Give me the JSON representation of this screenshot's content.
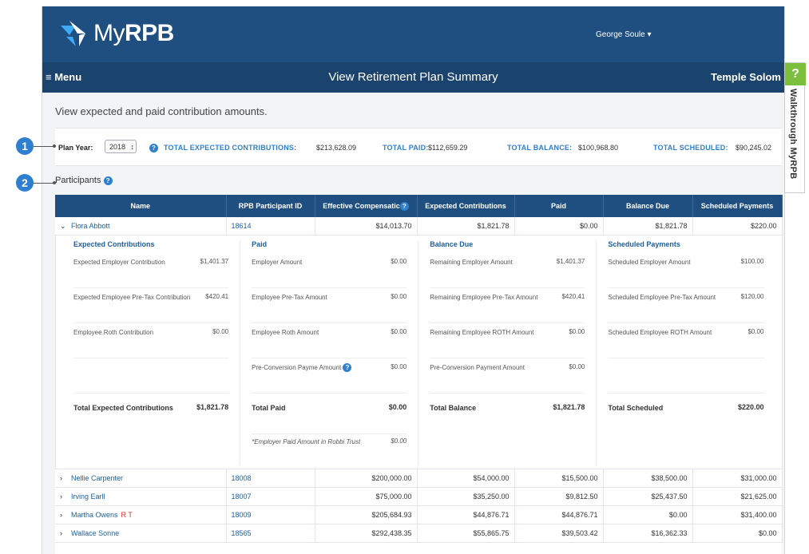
{
  "header": {
    "logo_text_my": "My",
    "logo_text_rpb": "RPB",
    "user_name": "George Soule"
  },
  "menubar": {
    "menu_label": "Menu",
    "page_title": "View Retirement Plan Summary",
    "organization": "Temple Solom"
  },
  "intro": "View expected and paid contribution amounts.",
  "plan": {
    "year_label": "Plan Year:",
    "year_value": "2018",
    "totals": [
      {
        "label": "TOTAL EXPECTED CONTRIBUTIONS:",
        "value": "$213,628.09"
      },
      {
        "label": "TOTAL PAID:",
        "value": "$112,659.29"
      },
      {
        "label": "TOTAL BALANCE:",
        "value": "$100,968.80"
      },
      {
        "label": "TOTAL SCHEDULED:",
        "value": "$90,245.02"
      }
    ]
  },
  "participants_label": "Participants",
  "table": {
    "columns": [
      "Name",
      "RPB Participant ID",
      "Effective Compensatic",
      "Expected Contributions",
      "Paid",
      "Balance Due",
      "Scheduled Payments"
    ],
    "expanded": {
      "name": "Flora Abbott",
      "id": "18614",
      "comp": "$14,013.70",
      "expected": "$1,821.78",
      "paid": "$0.00",
      "balance": "$1,821.78",
      "scheduled": "$220.00"
    },
    "details": {
      "expected": {
        "title": "Expected Contributions",
        "rows": [
          {
            "label": "Expected Employer Contribution",
            "value": "$1,401.37"
          },
          {
            "label": "Expected Employee Pre-Tax Contribution",
            "value": "$420.41"
          },
          {
            "label": "Employee Roth Contribution",
            "value": "$0.00"
          }
        ],
        "total_label": "Total Expected Contributions",
        "total_value": "$1,821.78"
      },
      "paid": {
        "title": "Paid",
        "rows": [
          {
            "label": "Employer Amount",
            "value": "$0.00"
          },
          {
            "label": "Employee Pre-Tax Amount",
            "value": "$0.00"
          },
          {
            "label": "Employee Roth Amount",
            "value": "$0.00"
          },
          {
            "label": "Pre-Conversion Payme Amount",
            "value": "$0.00"
          }
        ],
        "total_label": "Total Paid",
        "total_value": "$0.00",
        "note_label": "*Employer Paid Amount in Robbi Trust",
        "note_value": "$0.00"
      },
      "balance": {
        "title": "Balance Due",
        "rows": [
          {
            "label": "Remaining Employer Amount",
            "value": "$1,401.37"
          },
          {
            "label": "Remaining Employee Pre-Tax Amount",
            "value": "$420.41"
          },
          {
            "label": "Remaining Employee ROTH Amount",
            "value": "$0.00"
          },
          {
            "label": "Pre-Conversion Payment Amount",
            "value": "$0.00"
          }
        ],
        "total_label": "Total Balance",
        "total_value": "$1,821.78"
      },
      "scheduled": {
        "title": "Scheduled Payments",
        "rows": [
          {
            "label": "Scheduled Employer Amount",
            "value": "$100.00"
          },
          {
            "label": "Scheduled Employee Pre-Tax Amount",
            "value": "$120.00"
          },
          {
            "label": "Scheduled Employee ROTH Amount",
            "value": "$0.00"
          }
        ],
        "total_label": "Total Scheduled",
        "total_value": "$220.00"
      }
    },
    "rows": [
      {
        "name": "Nellie Carpenter",
        "tag": "",
        "id": "18008",
        "comp": "$200,000.00",
        "expected": "$54,000.00",
        "paid": "$15,500.00",
        "balance": "$38,500.00",
        "scheduled": "$31,000.00"
      },
      {
        "name": "Irving Earll",
        "tag": "",
        "id": "18007",
        "comp": "$75,000.00",
        "expected": "$35,250.00",
        "paid": "$9,812.50",
        "balance": "$25,437.50",
        "scheduled": "$21,625.00"
      },
      {
        "name": "Martha Owens",
        "tag": "R T",
        "id": "18009",
        "comp": "$205,684.93",
        "expected": "$44,876.71",
        "paid": "$44,876.71",
        "balance": "$0.00",
        "scheduled": "$31,400.00"
      },
      {
        "name": "Wallace Sonne",
        "tag": "",
        "id": "18565",
        "comp": "$292,438.35",
        "expected": "$55,865.75",
        "paid": "$39,503.42",
        "balance": "$16,362.33",
        "scheduled": "$0.00"
      }
    ]
  },
  "callouts": [
    "1",
    "2"
  ],
  "walkthrough": {
    "icon": "?",
    "label": "Walkthrough MyRPB"
  },
  "colors": {
    "header_bg": "#1e4f80",
    "accent": "#2f7fd0",
    "walkthrough": "#7cbf3c"
  }
}
